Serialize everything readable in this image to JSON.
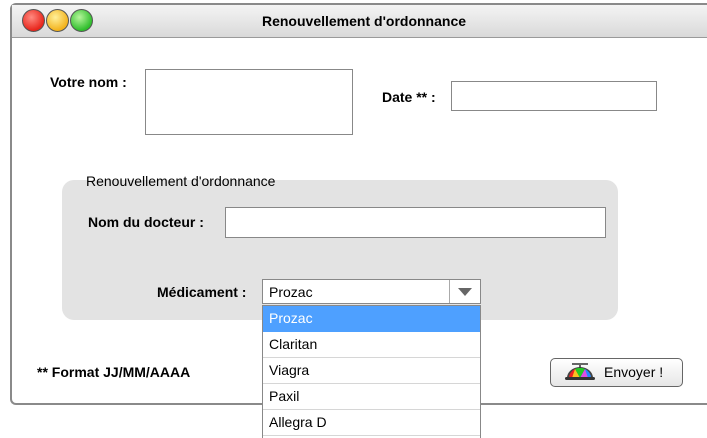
{
  "window": {
    "title": "Renouvellement d'ordonnance"
  },
  "form": {
    "name_label": "Votre nom :",
    "name_value": "",
    "date_label": "Date ** :",
    "date_value": "",
    "date_note": "** Format JJ/MM/AAAA"
  },
  "prescription": {
    "legend": "Renouvellement d'ordonnance",
    "doctor_label": "Nom du docteur :",
    "doctor_value": "",
    "medication_label": "Médicament :",
    "medication_selected": "Prozac",
    "medication_options": [
      "Prozac",
      "Claritan",
      "Viagra",
      "Paxil",
      "Allegra D"
    ]
  },
  "submit": {
    "label": "Envoyer !",
    "icon": "propeller-cap-icon"
  }
}
